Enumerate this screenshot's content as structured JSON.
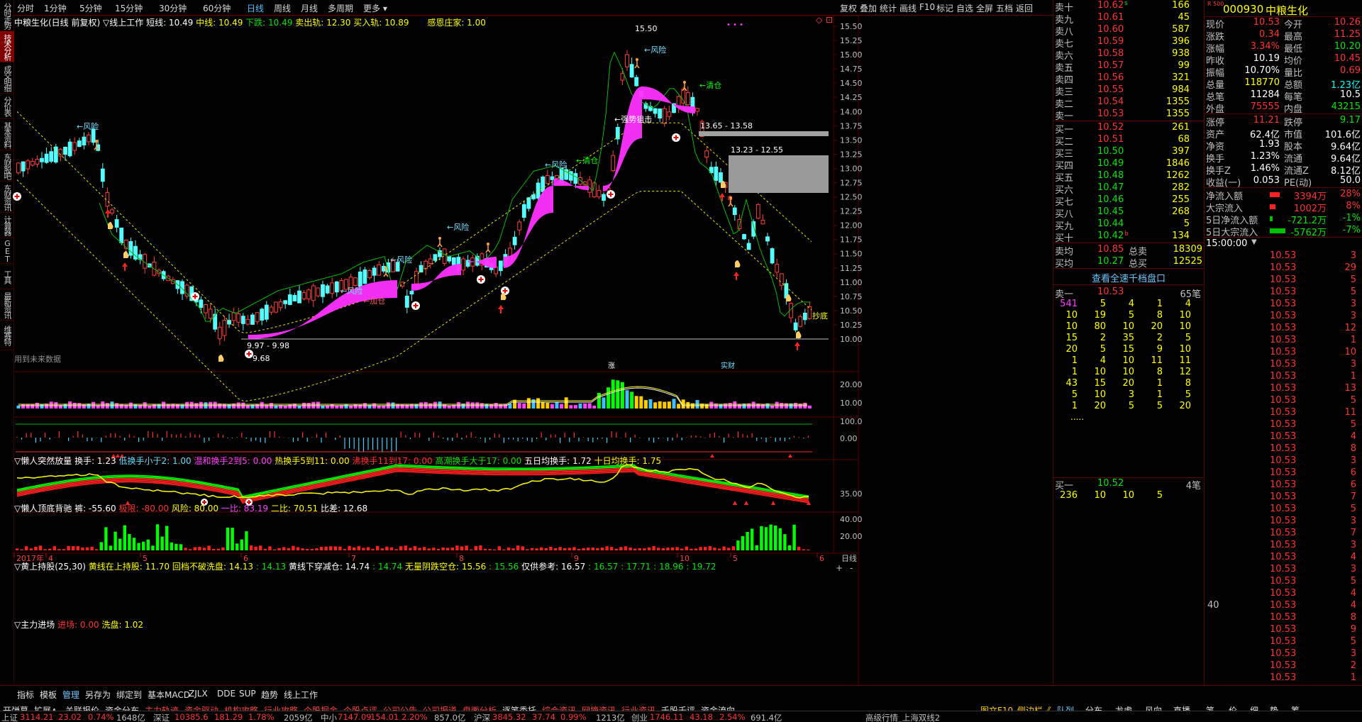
{
  "stock": {
    "code": "000930",
    "name": "中粮生化",
    "title_line": "中粮生化(日线 前复权)",
    "style_name": "▽线上工作"
  },
  "sidebar": [
    "分时走势",
    "技术分析",
    "成交明细",
    "分价表",
    "基本资料",
    "东财股吧",
    "东财资讯",
    "计算器",
    "GET",
    "工具",
    "最新资讯",
    "维赛特"
  ],
  "periods": [
    "分时",
    "1分钟",
    "5分钟",
    "15分钟",
    "30分钟",
    "60分钟",
    "日线",
    "周线",
    "月线",
    "多周期",
    "更多"
  ],
  "active_period": "日线",
  "toolbar": [
    "复权",
    "叠加",
    "统计",
    "画线",
    "F10",
    "标记",
    "自选",
    "全屏",
    "五档",
    "返回"
  ],
  "main_indicator": {
    "short": "短线: 10.49",
    "mid": "中线: 10.49",
    "down": "下跌: 10.49",
    "sell_track": "卖出轨: 12.30",
    "buy_track": "买入轨: 10.89",
    "thanks": "感恩庄家: 1.00"
  },
  "price_axis": [
    "15.50",
    "15.25",
    "15.00",
    "14.75",
    "14.50",
    "14.25",
    "14.00",
    "13.75",
    "13.50",
    "13.25",
    "13.00",
    "12.75",
    "12.50",
    "12.25",
    "12.00",
    "11.75",
    "11.50",
    "11.25",
    "11.00",
    "10.75",
    "10.50",
    "10.25",
    "10.00"
  ],
  "annotations": {
    "high": "15.50",
    "low_range": "9.97 - 9.98",
    "low": "9.68",
    "zone1": "13.65 - 13.58",
    "zone2": "13.23 - 12.55",
    "risk": "←风险",
    "clear": "←清仓",
    "add": "←加仓",
    "strong": "←强势狙击",
    "bottom": "抄底",
    "future": "用到未来数据",
    "zhang": "涨",
    "shi": "实财"
  },
  "ind1": {
    "name": "▽懒人突然放量",
    "turnover": "换手: 1.23",
    "low": "低换手小于2: 1.00",
    "mild": "温和换手2到5: 0.00",
    "hot": "热换手5到11: 0.00",
    "boil": "沸换手11到17: 0.00",
    "high": "高潮换手大于17: 0.00",
    "avg5": "五日均换手: 1.72",
    "avg10": "十日均换手: 1.75",
    "axis": [
      "20.00",
      "10.00"
    ]
  },
  "ind2": {
    "name": "▽懒人顶底背驰",
    "pan": "裤: -55.60",
    "bottom": "极限: -80.00",
    "risk": "风险: 80.00",
    "r1": "一比: 83.19",
    "r2": "二比: 70.51",
    "diff": "比差: 12.68",
    "axis": [
      "100.0",
      "0.00"
    ]
  },
  "ind3": {
    "name": "▽黄上持股(25,30)",
    "hold": "黄线在上持股: 11.70",
    "back": "回档不破洗盘: 14.13",
    "v1": ": 14.13",
    "down": "黄线下穿减仓: 14.74",
    "v2": ": 14.74",
    "empty": "无量阴跌空仓: 15.56",
    "v3": ": 15.56",
    "ref": "仅供参考: 16.57",
    "v4": ": 16.57",
    "v5": ": 17.71",
    "v6": ": 18.96",
    "v7": ": 19.72",
    "axis": [
      "35.00"
    ]
  },
  "ind4": {
    "name": "▽主力进场",
    "enter": "进场: 0.00",
    "wash": "洗盘: 1.02",
    "axis": [
      "40.00",
      "20.00"
    ]
  },
  "xaxis": [
    "2017年",
    "4",
    "5",
    "6",
    "7",
    "8",
    "9",
    "10",
    "5",
    "6"
  ],
  "period_label": "日线",
  "bottom_tabs": [
    "指标",
    "模板",
    "管理",
    "另存为",
    "绑定到",
    "基本MACD",
    "ZJLX",
    "DDE",
    "SUP",
    "趋势",
    "线上工作"
  ],
  "func_tabs": [
    "开弹幕",
    "扩展∧",
    "关联报价",
    "资金分布",
    "主力轨迹",
    "资金驱动",
    "机构攻略",
    "行业攻略",
    "个股掘金",
    "个股点评",
    "公司公告",
    "公司报道",
    "盘面分析",
    "逐笔委托",
    "综合资讯",
    "网摘资讯",
    "行业资讯",
    "千股千评",
    "资金流向"
  ],
  "right_tabs": [
    "图文F10",
    "侧边栏《",
    "队列",
    "分布",
    "龙虎",
    "风向",
    "直播",
    "笔",
    "价",
    "细",
    "势",
    "筹"
  ],
  "status": {
    "sh_label": "上证",
    "sh": "3114.21",
    "sh_chg": "23.02",
    "sh_pct": "0.74%",
    "sh_amt": "1648亿",
    "sz_label": "深证",
    "sz": "10385.6",
    "sz_chg": "181.29",
    "sz_pct": "1.78%",
    "sz_amt": "2059亿",
    "zx_label": "中小",
    "zx": "7147.09",
    "zx_chg": "154.01",
    "zx_pct": "2.20%",
    "zx_amt": "857.0亿",
    "hs_label": "沪深",
    "hs": "3845.32",
    "hs_chg": "37.74",
    "hs_pct": "0.99%",
    "hs_amt": "1213亿",
    "cy_label": "创业",
    "cy": "1746.11",
    "cy_chg": "43.18",
    "cy_pct": "2.54%",
    "cy_amt": "691.4亿",
    "feed": "高级行情_上海双线2"
  },
  "asks": [
    {
      "l": "卖十",
      "p": "10.62",
      "v": "166",
      "m": "s"
    },
    {
      "l": "卖九",
      "p": "10.61",
      "v": "45"
    },
    {
      "l": "卖八",
      "p": "10.60",
      "v": "587"
    },
    {
      "l": "卖七",
      "p": "10.59",
      "v": "396"
    },
    {
      "l": "卖六",
      "p": "10.58",
      "v": "938"
    },
    {
      "l": "卖五",
      "p": "10.57",
      "v": "99"
    },
    {
      "l": "卖四",
      "p": "10.56",
      "v": "321"
    },
    {
      "l": "卖三",
      "p": "10.55",
      "v": "984"
    },
    {
      "l": "卖二",
      "p": "10.54",
      "v": "1355"
    },
    {
      "l": "卖一",
      "p": "10.53",
      "v": "1355"
    }
  ],
  "bids": [
    {
      "l": "买一",
      "p": "10.52",
      "v": "261"
    },
    {
      "l": "买二",
      "p": "10.51",
      "v": "68"
    },
    {
      "l": "买三",
      "p": "10.50",
      "v": "397"
    },
    {
      "l": "买四",
      "p": "10.49",
      "v": "1846"
    },
    {
      "l": "买五",
      "p": "10.48",
      "v": "1262"
    },
    {
      "l": "买六",
      "p": "10.47",
      "v": "282"
    },
    {
      "l": "买七",
      "p": "10.46",
      "v": "255"
    },
    {
      "l": "买八",
      "p": "10.45",
      "v": "268"
    },
    {
      "l": "买九",
      "p": "10.44",
      "v": "5"
    },
    {
      "l": "买十",
      "p": "10.42",
      "v": "134"
    }
  ],
  "avg": {
    "sell_avg_l": "卖均",
    "sell_avg": "10.85",
    "sell_total_l": "总卖",
    "sell_total": "18309",
    "buy_avg_l": "买均",
    "buy_avg": "10.27",
    "buy_total_l": "总买",
    "buy_total": "12525"
  },
  "queue_btn": "查看全速千档盘口",
  "sell1_queue": {
    "label": "卖一",
    "price": "10.53",
    "count": "65笔",
    "rows": [
      [
        "541",
        "5",
        "4",
        "1",
        "4"
      ],
      [
        "10",
        "19",
        "5",
        "8",
        "10"
      ],
      [
        "10",
        "80",
        "10",
        "20",
        "10"
      ],
      [
        "15",
        "2",
        "35",
        "2",
        "5"
      ],
      [
        "20",
        "5",
        "15",
        "9",
        "10"
      ],
      [
        "1",
        "4",
        "10",
        "11",
        "11"
      ],
      [
        "1",
        "10",
        "10",
        "8",
        "12"
      ],
      [
        "43",
        "15",
        "20",
        "1",
        "8"
      ],
      [
        "5",
        "10",
        "3",
        "1",
        "5"
      ],
      [
        "1",
        "20",
        "5",
        "5",
        "20"
      ]
    ],
    "more": "....."
  },
  "buy1_queue": {
    "label": "买一",
    "price": "10.52",
    "count": "4笔",
    "rows": [
      [
        "236",
        "10",
        "10",
        "5"
      ]
    ]
  },
  "quote_rows": [
    [
      "现价",
      "10.53",
      "今开",
      "10.26"
    ],
    [
      "涨跌",
      "0.34",
      "最高",
      "11.25"
    ],
    [
      "涨幅",
      "3.34%",
      "最低",
      "10.20"
    ],
    [
      "昨收",
      "10.19",
      "均价",
      "10.45"
    ],
    [
      "振幅",
      "10.70%",
      "量比",
      "0.69"
    ],
    [
      "总量",
      "118770",
      "总额",
      "1.23亿"
    ],
    [
      "总笔",
      "11284",
      "每笔",
      "10.5"
    ],
    [
      "外盘",
      "75555",
      "内盘",
      "43215"
    ]
  ],
  "quote_rows2": [
    [
      "涨停",
      "11.21",
      "跌停",
      "9.17"
    ],
    [
      "资产",
      "62.4亿",
      "市值",
      "101.6亿"
    ],
    [
      "净资",
      "1.93",
      "股本",
      "9.64亿"
    ],
    [
      "换手",
      "1.23%",
      "流通",
      "9.64亿"
    ],
    [
      "换手Z",
      "1.46%",
      "流通Z",
      "8.12亿"
    ],
    [
      "收益(一)",
      "0.053",
      "PE(动)",
      "50.0"
    ]
  ],
  "flows": [
    {
      "l": "净流入额",
      "v": "3394万",
      "p": "28%"
    },
    {
      "l": "大宗流入",
      "v": "1002万",
      "p": "8%"
    },
    {
      "l": "5日净流入额",
      "v": "-721.2万",
      "p": "-1%"
    },
    {
      "l": "5日大宗流入",
      "v": "-5762万",
      "p": "-7%"
    }
  ],
  "ticks_header": "15:00:00",
  "ticks": [
    [
      "10.53",
      "3"
    ],
    [
      "10.53",
      "29"
    ],
    [
      "10.53",
      "5"
    ],
    [
      "10.53",
      "5"
    ],
    [
      "10.53",
      "3"
    ],
    [
      "10.53",
      "3"
    ],
    [
      "10.53",
      "12"
    ],
    [
      "10.53",
      "1"
    ],
    [
      "10.53",
      "10"
    ],
    [
      "10.53",
      "3"
    ],
    [
      "10.53",
      "1"
    ],
    [
      "10.53",
      "13"
    ],
    [
      "10.53",
      "5"
    ],
    [
      "10.53",
      "11"
    ],
    [
      "10.53",
      "5"
    ],
    [
      "10.53",
      "4"
    ],
    [
      "10.53",
      "8"
    ],
    [
      "10.53",
      "3"
    ],
    [
      "10.53",
      "6"
    ],
    [
      "10.53",
      "6"
    ],
    [
      "10.53",
      "7"
    ],
    [
      "10.53",
      "5"
    ],
    [
      "10.53",
      "3"
    ],
    [
      "10.53",
      "7"
    ],
    [
      "10.53",
      "3"
    ],
    [
      "10.53",
      "4"
    ],
    [
      "10.53",
      "3"
    ],
    [
      "10.53",
      "5"
    ],
    [
      "10.53",
      "4"
    ],
    [
      "10.53",
      "4"
    ],
    [
      "10.53",
      "8"
    ],
    [
      "10.53",
      "9"
    ],
    [
      "10.53",
      "5"
    ],
    [
      "10.53",
      "3"
    ],
    [
      "10.53",
      "2"
    ],
    [
      "10.53",
      "1"
    ],
    [
      "10.53",
      "3"
    ],
    [
      "10.53",
      "29"
    ],
    [
      "10.53",
      "3"
    ]
  ],
  "ticks_prefix": [
    "",
    "",
    "",
    "",
    "",
    "",
    "",
    "",
    "",
    "",
    "",
    "",
    "",
    "",
    "",
    "",
    "",
    "",
    "",
    "",
    "",
    "",
    "",
    "",
    "",
    "",
    "",
    "",
    "",
    "40",
    "",
    "",
    "",
    "",
    "",
    "",
    "",
    "",
    ""
  ]
}
